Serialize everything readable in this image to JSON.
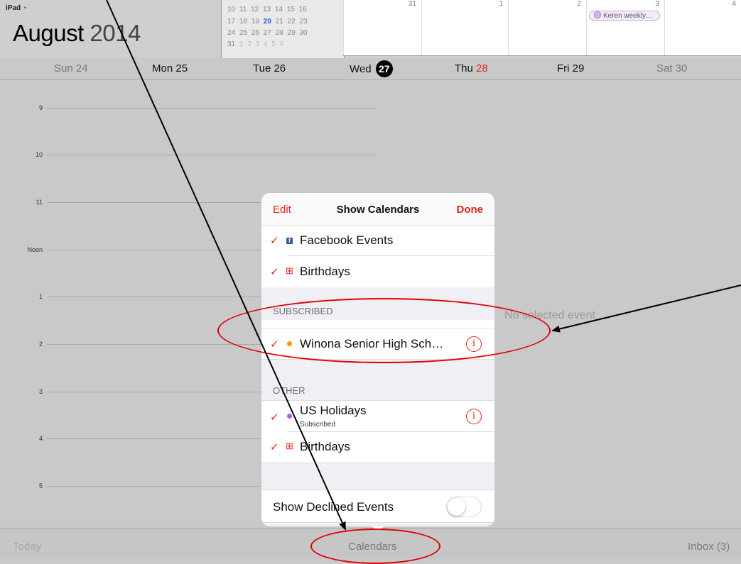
{
  "status": {
    "device": "iPad"
  },
  "header": {
    "month": "August",
    "year": "2014"
  },
  "mini_calendar": {
    "rows": [
      {
        "days": [
          "10",
          "11",
          "12",
          "13",
          "14",
          "15",
          "16"
        ]
      },
      {
        "days": [
          "17",
          "18",
          "19",
          "20",
          "21",
          "22",
          "23"
        ],
        "today": "20"
      },
      {
        "days": [
          "24",
          "25",
          "26",
          "27",
          "28",
          "29",
          "30"
        ]
      },
      {
        "days": [
          "31",
          "1",
          "2",
          "3",
          "4",
          "5",
          "6"
        ]
      }
    ]
  },
  "month_grid": {
    "dates": [
      "31",
      "1",
      "2",
      "3",
      "4"
    ],
    "event": "Keren weekly…"
  },
  "week": {
    "days": [
      {
        "label": "Sun 24"
      },
      {
        "label": "Mon 25"
      },
      {
        "label": "Tue 26"
      },
      {
        "label": "Wed",
        "num": "27"
      },
      {
        "label": "Thu",
        "num": "28"
      },
      {
        "label": "Fri 29"
      },
      {
        "label": "Sat 30"
      }
    ]
  },
  "hours": [
    "9",
    "10",
    "11",
    "Noon",
    "1",
    "2",
    "3",
    "4",
    "5"
  ],
  "detail": {
    "empty_text": "No selected event"
  },
  "popover": {
    "edit": "Edit",
    "title": "Show Calendars",
    "done": "Done",
    "rows_top": [
      {
        "label": "Facebook Events",
        "icon": "facebook-icon"
      },
      {
        "label": "Birthdays",
        "icon": "gift-icon"
      }
    ],
    "subscribed_header": "SUBSCRIBED",
    "subscribed": [
      {
        "label": "Winona Senior High Sch…",
        "color": "#ff9500"
      }
    ],
    "other_header": "OTHER",
    "other": [
      {
        "label": "US Holidays",
        "sub": "Subscribed",
        "color": "#b05fd6"
      },
      {
        "label": "Birthdays",
        "icon": "gift-icon"
      }
    ],
    "declined_label": "Show Declined Events",
    "declined_on": false
  },
  "bottom_bar": {
    "today": "Today",
    "calendars": "Calendars",
    "inbox": "Inbox (3)"
  },
  "colors": {
    "accent": "#e0261e",
    "annotation": "#e20000"
  }
}
